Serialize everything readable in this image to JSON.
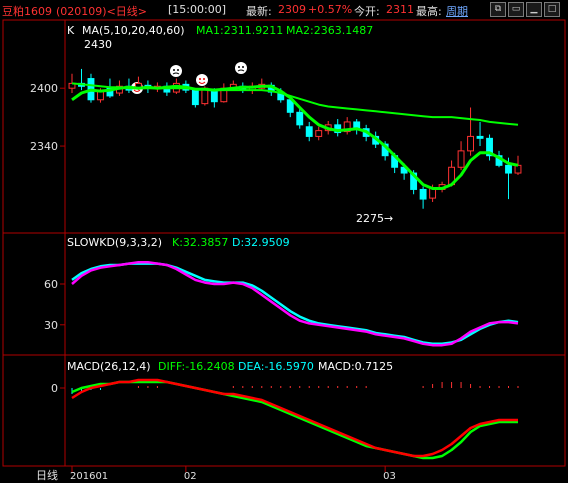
{
  "header": {
    "symbol": "豆粕1609",
    "code_period": "(020109)<日线>",
    "time": "[15:00:00]",
    "latest_label": "最新:",
    "latest_value": "2309",
    "change_pct": "+0.57%",
    "open_label": "今开:",
    "open_value": "2311",
    "high_label": "最高:",
    "high_value": "周期"
  },
  "colors": {
    "up": "#ff3232",
    "down": "#00ffff",
    "ma1": "#00ff00",
    "ma2": "#00ff00",
    "k_line": "#ff00ff",
    "d_line": "#00ffff",
    "diff": "#ff0000",
    "dea": "#00ff00",
    "frame": "#b00000",
    "accent_header": "#ff3232"
  },
  "chart_data": [
    {
      "type": "candlestick",
      "legend": {
        "k_label": "K",
        "ma_label": "MA(5,10,20,40,60)",
        "ma1_label": "MA1:2311.9211",
        "ma2_label": "MA2:2363.1487"
      },
      "yticks": [
        2400,
        2340
      ],
      "ylim": [
        2255,
        2450
      ],
      "annotations": {
        "high": "2430",
        "low": "2275"
      },
      "candles": [
        [
          2400,
          2405,
          2415,
          2395
        ],
        [
          2405,
          2402,
          2420,
          2398
        ],
        [
          2410,
          2388,
          2415,
          2385
        ],
        [
          2388,
          2398,
          2400,
          2385
        ],
        [
          2400,
          2392,
          2410,
          2390
        ],
        [
          2395,
          2402,
          2408,
          2392
        ],
        [
          2402,
          2398,
          2410,
          2395
        ],
        [
          2400,
          2405,
          2412,
          2398
        ],
        [
          2403,
          2400,
          2408,
          2395
        ],
        [
          2400,
          2402,
          2406,
          2396
        ],
        [
          2402,
          2396,
          2406,
          2392
        ],
        [
          2396,
          2405,
          2410,
          2394
        ],
        [
          2404,
          2398,
          2408,
          2395
        ],
        [
          2398,
          2383,
          2400,
          2380
        ],
        [
          2384,
          2400,
          2402,
          2382
        ],
        [
          2398,
          2386,
          2400,
          2380
        ],
        [
          2386,
          2400,
          2405,
          2385
        ],
        [
          2400,
          2404,
          2408,
          2398
        ],
        [
          2402,
          2398,
          2406,
          2395
        ],
        [
          2398,
          2402,
          2406,
          2394
        ],
        [
          2400,
          2404,
          2410,
          2398
        ],
        [
          2403,
          2396,
          2406,
          2392
        ],
        [
          2396,
          2388,
          2400,
          2385
        ],
        [
          2388,
          2375,
          2390,
          2370
        ],
        [
          2375,
          2362,
          2380,
          2358
        ],
        [
          2360,
          2350,
          2365,
          2345
        ],
        [
          2350,
          2356,
          2360,
          2346
        ],
        [
          2356,
          2362,
          2366,
          2352
        ],
        [
          2362,
          2354,
          2368,
          2350
        ],
        [
          2355,
          2365,
          2370,
          2352
        ],
        [
          2365,
          2358,
          2368,
          2352
        ],
        [
          2358,
          2350,
          2362,
          2345
        ],
        [
          2350,
          2342,
          2355,
          2338
        ],
        [
          2342,
          2330,
          2345,
          2325
        ],
        [
          2330,
          2318,
          2333,
          2312
        ],
        [
          2318,
          2312,
          2322,
          2305
        ],
        [
          2312,
          2295,
          2315,
          2290
        ],
        [
          2295,
          2285,
          2298,
          2275
        ],
        [
          2286,
          2296,
          2300,
          2282
        ],
        [
          2295,
          2300,
          2303,
          2292
        ],
        [
          2300,
          2318,
          2325,
          2298
        ],
        [
          2318,
          2335,
          2345,
          2315
        ],
        [
          2335,
          2350,
          2380,
          2330
        ],
        [
          2350,
          2348,
          2365,
          2340
        ],
        [
          2348,
          2330,
          2352,
          2325
        ],
        [
          2330,
          2320,
          2335,
          2318
        ],
        [
          2320,
          2312,
          2328,
          2285
        ],
        [
          2312,
          2320,
          2330,
          2310
        ]
      ],
      "ma1": [
        2388,
        2395,
        2398,
        2397,
        2398,
        2400,
        2401,
        2400,
        2401,
        2400,
        2401,
        2402,
        2401,
        2399,
        2399,
        2398,
        2399,
        2400,
        2401,
        2401,
        2402,
        2402,
        2397,
        2390,
        2380,
        2370,
        2362,
        2358,
        2356,
        2357,
        2358,
        2355,
        2348,
        2340,
        2330,
        2320,
        2310,
        2300,
        2296,
        2296,
        2300,
        2310,
        2325,
        2333,
        2333,
        2328,
        2322,
        2320
      ],
      "ma2": [
        2405,
        2404,
        2403,
        2402,
        2401,
        2401,
        2400,
        2400,
        2400,
        2400,
        2400,
        2400,
        2400,
        2399,
        2399,
        2398,
        2398,
        2398,
        2398,
        2398,
        2398,
        2397,
        2395,
        2392,
        2389,
        2386,
        2383,
        2381,
        2380,
        2379,
        2378,
        2377,
        2376,
        2375,
        2374,
        2373,
        2372,
        2371,
        2370,
        2370,
        2370,
        2369,
        2368,
        2367,
        2365,
        2364,
        2363,
        2362
      ]
    },
    {
      "type": "line",
      "legend": {
        "label": "SLOWKD(9,3,3,2)",
        "k_label": "K:32.3857",
        "d_label": "D:32.9509"
      },
      "yticks": [
        60,
        30
      ],
      "ylim": [
        10,
        85
      ],
      "k": [
        60,
        66,
        70,
        72,
        73,
        74,
        75,
        76,
        76,
        75,
        74,
        71,
        67,
        63,
        61,
        60,
        60,
        61,
        60,
        57,
        52,
        47,
        42,
        37,
        33,
        31,
        30,
        29,
        28,
        27,
        26,
        25,
        23,
        22,
        21,
        20,
        18,
        16,
        15,
        15,
        16,
        20,
        25,
        28,
        31,
        32,
        32,
        31
      ],
      "d": [
        63,
        68,
        71,
        73,
        74,
        74,
        75,
        75,
        75,
        75,
        74,
        72,
        69,
        66,
        63,
        62,
        61,
        61,
        61,
        59,
        55,
        50,
        45,
        40,
        36,
        33,
        31,
        30,
        29,
        28,
        27,
        26,
        24,
        23,
        22,
        21,
        19,
        17,
        16,
        16,
        17,
        19,
        23,
        27,
        30,
        32,
        33,
        32
      ]
    },
    {
      "type": "line",
      "legend": {
        "label": "MACD(26,12,4)",
        "diff_label": "DIFF:-16.2408",
        "dea_label": "DEA:-16.5970",
        "macd_label": "MACD:0.7125"
      },
      "yticks": [
        0
      ],
      "ylim": [
        -37,
        8
      ],
      "diff": [
        -5,
        -2,
        0,
        1,
        2,
        3,
        3,
        4,
        4,
        4,
        3,
        2,
        1,
        0,
        -1,
        -2,
        -3,
        -3,
        -4,
        -5,
        -6,
        -8,
        -10,
        -12,
        -14,
        -16,
        -18,
        -20,
        -22,
        -24,
        -26,
        -28,
        -30,
        -31,
        -32,
        -33,
        -34,
        -34,
        -33,
        -31,
        -28,
        -24,
        -20,
        -18,
        -17,
        -16,
        -16,
        -16
      ],
      "dea": [
        -2,
        0,
        1,
        2,
        2,
        3,
        3,
        3,
        3,
        3,
        3,
        2,
        1,
        0,
        -1,
        -2,
        -3,
        -4,
        -5,
        -6,
        -7,
        -9,
        -11,
        -13,
        -15,
        -17,
        -19,
        -21,
        -23,
        -25,
        -27,
        -29,
        -30,
        -31,
        -32,
        -33,
        -34,
        -35,
        -35,
        -34,
        -31,
        -27,
        -22,
        -19,
        -18,
        -17,
        -17,
        -17
      ],
      "macd": [
        -3,
        -2,
        -1,
        -1,
        0,
        0,
        0,
        1,
        1,
        1,
        0,
        0,
        0,
        0,
        0,
        0,
        0,
        1,
        1,
        1,
        1,
        1,
        1,
        1,
        1,
        1,
        1,
        1,
        1,
        1,
        1,
        1,
        0,
        0,
        0,
        0,
        0,
        1,
        2,
        3,
        3,
        3,
        2,
        1,
        1,
        1,
        1,
        1
      ]
    }
  ],
  "xaxis": {
    "period_label": "日线",
    "ticks": [
      {
        "index": 0,
        "label": "201601"
      },
      {
        "index": 12,
        "label": "02"
      },
      {
        "index": 33,
        "label": "03"
      }
    ]
  }
}
